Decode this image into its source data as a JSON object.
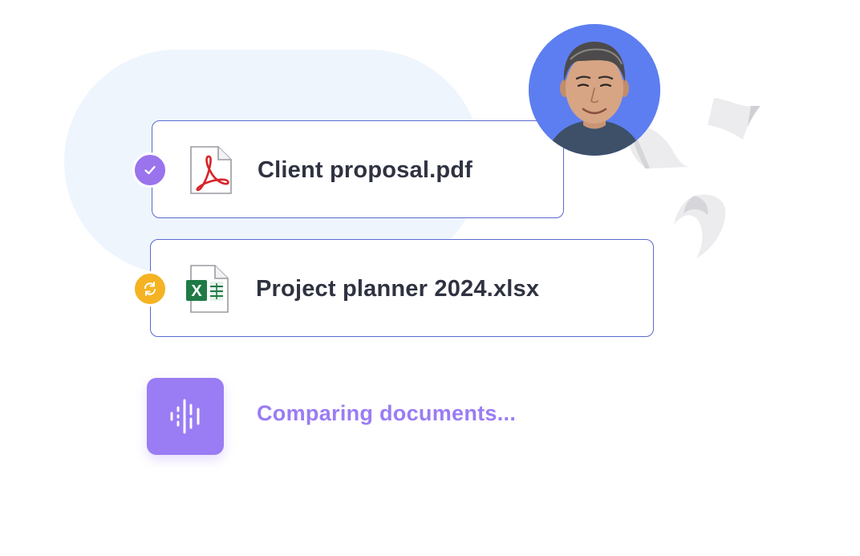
{
  "files": [
    {
      "name": "Client proposal.pdf",
      "type_icon": "pdf-icon",
      "status": "done",
      "status_icon": "checkmark-icon"
    },
    {
      "name": "Project planner 2024.xlsx",
      "type_icon": "excel-icon",
      "status": "syncing",
      "status_icon": "sync-icon"
    }
  ],
  "excel_icon_letter": "X",
  "status": {
    "label": "Comparing documents...",
    "icon": "audio-waveform-icon"
  },
  "user": {
    "avatar_icon": "user-avatar"
  },
  "colors": {
    "accent_purple": "#9a7cf4",
    "card_border": "#5b6ad0",
    "sync_yellow": "#f5b323",
    "avatar_bg": "#5d7ef0",
    "blob_bg": "#eef5fd",
    "text_dark": "#2f3240",
    "pdf_red": "#d8232a",
    "excel_green": "#1f7a45"
  }
}
